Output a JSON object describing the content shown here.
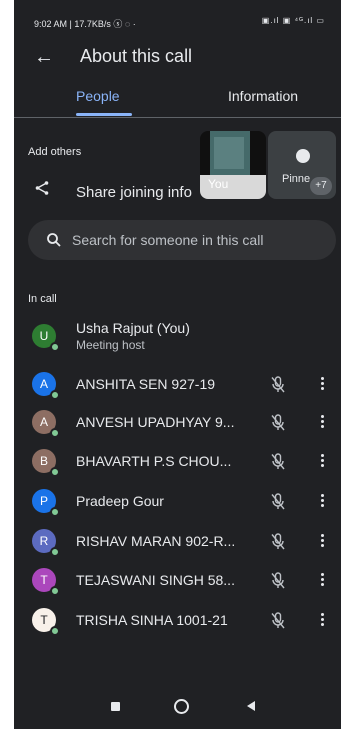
{
  "status_bar": {
    "left": "9:02 AM | 17.7KB/s ⓢ ◌ ·",
    "right": "▣.ıl ▣ ⁴ᴳ.ıl ▭"
  },
  "header": {
    "back_icon": "arrow-left-icon",
    "title": "About this call"
  },
  "tabs": [
    {
      "label": "People",
      "active": true
    },
    {
      "label": "Information",
      "active": false
    }
  ],
  "add_others": {
    "label": "Add others",
    "share_label": "Share joining info"
  },
  "tiles": {
    "self_label": "You",
    "pinned_label": "Pinne",
    "more_count": "+7"
  },
  "search": {
    "placeholder": "Search for someone in this call"
  },
  "in_call": {
    "label": "In call",
    "participants": [
      {
        "initial": "U",
        "name": "Usha Rajput (You)",
        "subtitle": "Meeting host",
        "color": "#2e7d32"
      },
      {
        "initial": "A",
        "name": "ANSHITA SEN 927-19",
        "color": "#1a73e8"
      },
      {
        "initial": "A",
        "name": "ANVESH UPADHYAY 9...",
        "color": "#8d6e63"
      },
      {
        "initial": "B",
        "name": "BHAVARTH P.S CHOU...",
        "color": "#8d6e63"
      },
      {
        "initial": "P",
        "name": "Pradeep Gour",
        "color": "#1a73e8"
      },
      {
        "initial": "R",
        "name": "RISHAV MARAN 902-R...",
        "color": "#5c6bc0"
      },
      {
        "initial": "T",
        "name": "TEJASWANI SINGH 58...",
        "color": "#ab47bc"
      },
      {
        "initial": "T",
        "name": "TRISHA SINHA 1001-21",
        "color": "#f8f1ea"
      }
    ]
  },
  "colors": {
    "background": "#202124",
    "accent": "#8ab4f8",
    "online": "#81c995"
  }
}
